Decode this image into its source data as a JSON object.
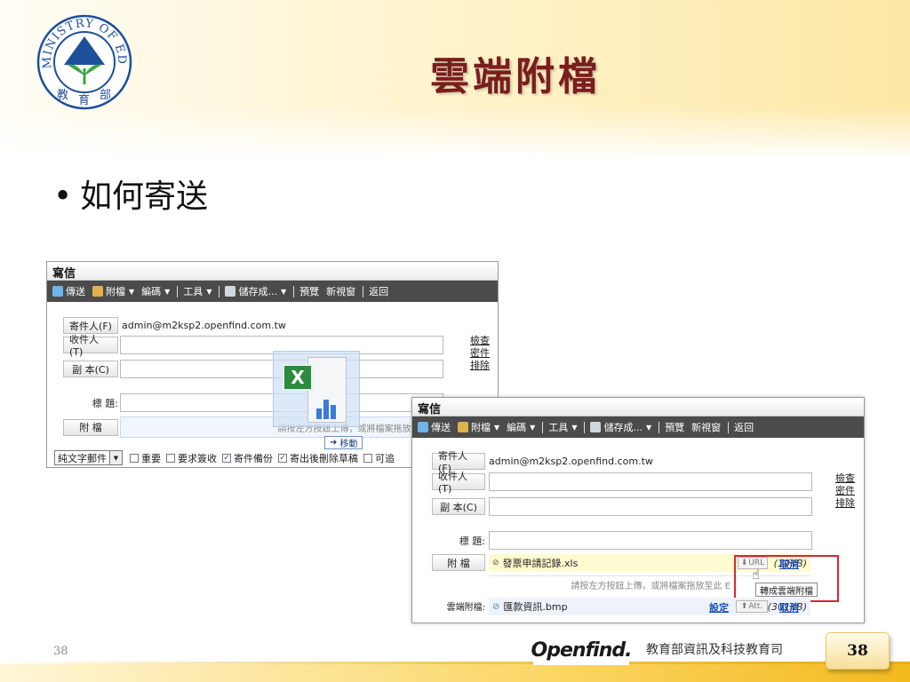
{
  "slide": {
    "title": "雲端附檔",
    "bullet": "如何寄送",
    "page_number": "38",
    "page_box": "38",
    "department": "教育部資訊及科技教育司",
    "openfind_logo": "Openfind."
  },
  "logo": {
    "ring_text": "MINISTRY OF EDUCATION",
    "chars": [
      "教",
      "育",
      "部"
    ]
  },
  "toolbar": {
    "send": "傳送",
    "attach": "附檔",
    "encoding": "編碼",
    "tools": "工具",
    "save_as": "儲存成...",
    "preview": "預覽",
    "new_window": "新視窗",
    "back": "返回"
  },
  "window1": {
    "title": "寫信",
    "from_btn": "寄件人(F)",
    "from_value": "admin@m2ksp2.openfind.com.tw",
    "to_btn": "收件人(T)",
    "cc_btn": "副 本(C)",
    "subject_label": "標 題:",
    "attach_btn": "附 檔",
    "drop_hint": "請按左方按鈕上傳，或將檔案拖放至此 E",
    "move_tip": "移動",
    "links": [
      "檢查",
      "密件",
      "排除"
    ],
    "format_select": "純文字郵件",
    "options": [
      "重要",
      "要求簽收",
      "寄件備份",
      "寄出後刪除草稿",
      "可追"
    ],
    "options_checked": [
      false,
      false,
      true,
      true,
      false
    ]
  },
  "window2": {
    "title": "寫信",
    "from_btn": "寄件人(F)",
    "from_value": "admin@m2ksp2.openfind.com.tw",
    "to_btn": "收件人(T)",
    "cc_btn": "副 本(C)",
    "subject_label": "標 題:",
    "attach_btn": "附 檔",
    "links": [
      "檢查",
      "密件",
      "排除"
    ],
    "attach_file": "發票申請記錄.xls",
    "attach_size": "(10KB)",
    "url_btn": "URL",
    "cancel_1": "取消",
    "drop_hint": "請按左方按鈕上傳，或將檔案拖放至此 E",
    "tooltip": "轉成雲端附檔",
    "cloud_label": "雲端附檔:",
    "cloud_file": "匯款資訊.bmp",
    "cloud_size": "(301KB)",
    "setting": "設定",
    "att_btn": "Att.",
    "cancel_2": "取消"
  },
  "colors": {
    "title": "#7a1d1d",
    "toolbar_bg": "#4b4b4b",
    "highlight_box": "#d9272e",
    "link_blue": "#1f4fb8"
  }
}
